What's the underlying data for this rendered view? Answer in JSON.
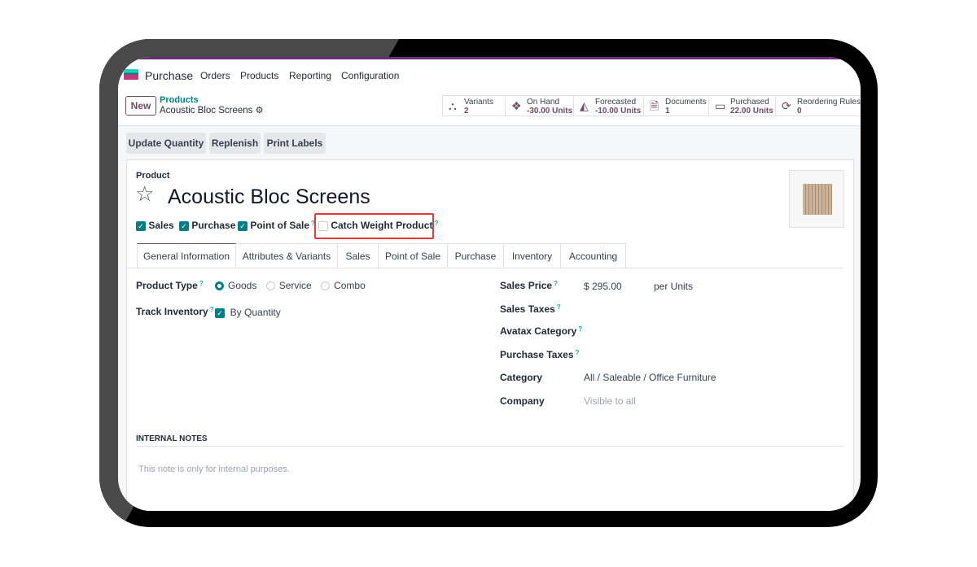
{
  "app": {
    "name": "Purchase",
    "menu": [
      "Orders",
      "Products",
      "Reporting",
      "Configuration"
    ]
  },
  "control_panel": {
    "new_label": "New",
    "breadcrumb_parent": "Products",
    "breadcrumb_current": "Acoustic Bloc Screens"
  },
  "stats": [
    {
      "label": "Variants",
      "value": "2",
      "icon": "sitemap-icon"
    },
    {
      "label": "On Hand",
      "value": "-30.00 Units",
      "icon": "cubes-icon"
    },
    {
      "label": "Forecasted",
      "value": "-10.00 Units",
      "icon": "area-chart-icon"
    },
    {
      "label": "Documents",
      "value": "1",
      "icon": "document-icon"
    },
    {
      "label": "Purchased",
      "value": "22.00 Units",
      "icon": "credit-card-icon"
    },
    {
      "label": "Reordering Rules",
      "value": "0",
      "icon": "refresh-icon"
    }
  ],
  "actions": [
    "Update Quantity",
    "Replenish",
    "Print Labels"
  ],
  "form": {
    "section_label": "Product",
    "title": "Acoustic Bloc Screens",
    "flags": [
      {
        "label": "Sales",
        "checked": true
      },
      {
        "label": "Purchase",
        "checked": true
      },
      {
        "label": "Point of Sale",
        "checked": true,
        "help": "?"
      },
      {
        "label": "Catch Weight Product",
        "checked": false,
        "help": "?"
      }
    ],
    "highlight_color": "#e53935",
    "tabs": [
      "General Information",
      "Attributes & Variants",
      "Sales",
      "Point of Sale",
      "Purchase",
      "Inventory",
      "Accounting"
    ],
    "left": {
      "product_type_label": "Product Type",
      "product_type_options": [
        "Goods",
        "Service",
        "Combo"
      ],
      "product_type_selected": "Goods",
      "track_inventory_label": "Track Inventory",
      "track_inventory_value": "By Quantity"
    },
    "right": {
      "sales_price_label": "Sales Price",
      "sales_price": "$ 295.00",
      "sales_price_unit": "per Units",
      "sales_taxes_label": "Sales Taxes",
      "avatax_label": "Avatax Category",
      "purchase_taxes_label": "Purchase Taxes",
      "category_label": "Category",
      "category_value": "All / Saleable / Office Furniture",
      "company_label": "Company",
      "company_placeholder": "Visible to all"
    },
    "notes_heading": "INTERNAL NOTES",
    "notes_placeholder": "This note is only for internal purposes."
  },
  "colors": {
    "brand": "#714b67",
    "accent": "#017e84"
  }
}
